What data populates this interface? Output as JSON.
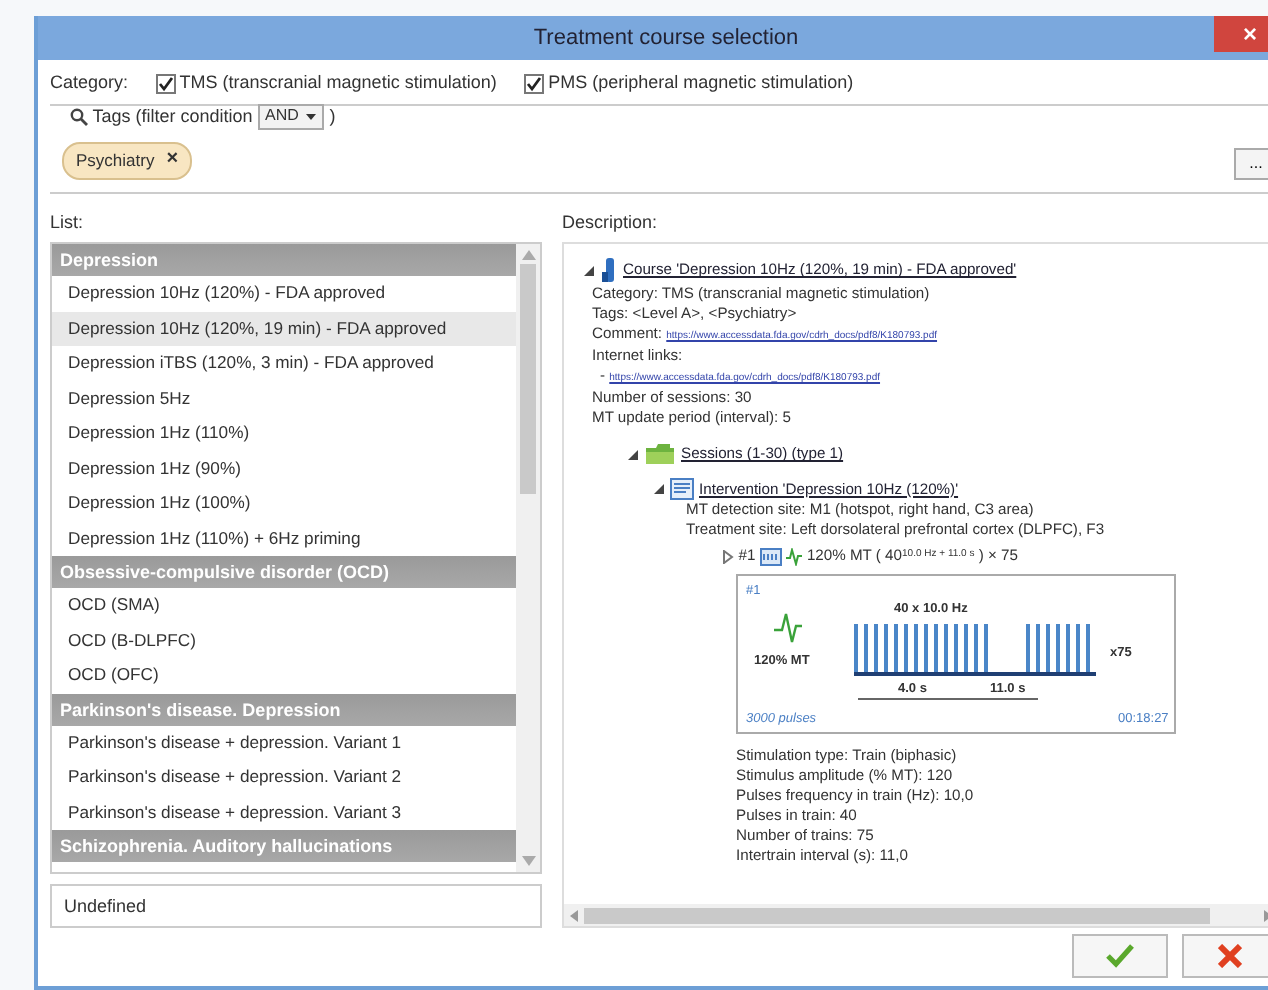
{
  "window": {
    "title": "Treatment course selection",
    "close": "×"
  },
  "category": {
    "label": "Category:",
    "options": [
      {
        "label": "TMS (transcranial magnetic stimulation)",
        "checked": true
      },
      {
        "label": "PMS (peripheral magnetic stimulation)",
        "checked": true
      }
    ]
  },
  "tags": {
    "label": "Tags (filter condition",
    "condition": "AND",
    "suffix": ")",
    "chips": [
      {
        "label": "Psychiatry",
        "remove": "×"
      }
    ],
    "more_button": "..."
  },
  "list": {
    "label": "List:",
    "groups": [
      {
        "title": "Depression",
        "items": [
          {
            "label": "Depression 10Hz (120%) - FDA approved",
            "selected": false
          },
          {
            "label": "Depression 10Hz (120%, 19 min) - FDA approved",
            "selected": true
          },
          {
            "label": "Depression iTBS (120%, 3 min) - FDA approved",
            "selected": false
          },
          {
            "label": "Depression 5Hz",
            "selected": false
          },
          {
            "label": "Depression 1Hz (110%)",
            "selected": false
          },
          {
            "label": "Depression 1Hz (90%)",
            "selected": false
          },
          {
            "label": "Depression 1Hz (100%)",
            "selected": false
          },
          {
            "label": "Depression 1Hz (110%) + 6Hz priming",
            "selected": false
          }
        ]
      },
      {
        "title": "Obsessive-compulsive disorder (OCD)",
        "items": [
          {
            "label": "OCD (SMA)",
            "selected": false
          },
          {
            "label": "OCD (B-DLPFC)",
            "selected": false
          },
          {
            "label": "OCD (OFC)",
            "selected": false
          }
        ]
      },
      {
        "title": "Parkinson's disease. Depression",
        "items": [
          {
            "label": "Parkinson's disease + depression. Variant 1",
            "selected": false
          },
          {
            "label": "Parkinson's disease + depression. Variant 2",
            "selected": false
          },
          {
            "label": "Parkinson's disease + depression. Variant 3",
            "selected": false
          }
        ]
      },
      {
        "title": "Schizophrenia. Auditory hallucinations"
      }
    ],
    "undefined_item": "Undefined"
  },
  "description": {
    "label": "Description:",
    "course": {
      "title": "Course 'Depression 10Hz (120%, 19 min) - FDA approved'",
      "expanded": true,
      "lines": [
        "Category: TMS (transcranial magnetic stimulation)",
        "Tags: <Level A>, <Psychiatry>"
      ],
      "comment_label": "Comment:",
      "comment_link": "https://www.accessdata.fda.gov/cdrh_docs/pdf8/K180793.pdf",
      "links_label": "Internet links:",
      "links": [
        {
          "bullet": "-",
          "url": "https://www.accessdata.fda.gov/cdrh_docs/pdf8/K180793.pdf"
        }
      ],
      "more_lines": [
        "Number of sessions: 30",
        "MT update period (interval): 5"
      ],
      "sessions": {
        "title": "Sessions (1-30) (type 1)",
        "expanded": true,
        "intervention": {
          "title": "Intervention 'Depression 10Hz (120%)'",
          "expanded": true,
          "lines": [
            "MT detection site: M1 (hotspot, right hand, C3 area)",
            "Treatment site: Left dorsolateral prefrontal cortex (DLPFC), F3"
          ],
          "protocol": {
            "expanded": false,
            "index": "#1",
            "summary": "120% MT  ( 40$^{10.0 Hz + 11.0 s}$ ) × 75",
            "diagram": {
              "index": "#1",
              "amplitude": "120% MT",
              "train_label": "40 x 10.0 Hz",
              "repeat": "x75",
              "on_time": "4.0 s",
              "off_time": "11.0 s",
              "pulses": "3000 pulses",
              "duration": "00:18:27"
            }
          },
          "params": [
            "Stimulation type: Train (biphasic)",
            "Stimulus amplitude (% MT): 120",
            "Pulses frequency in train (Hz): 10,0",
            "Pulses in train: 40",
            "Number of trains: 75",
            "Intertrain interval (s): 11,0"
          ]
        }
      }
    }
  },
  "footer": {
    "buttons": [
      {
        "kind": "ok"
      },
      {
        "kind": "cancel"
      }
    ]
  }
}
